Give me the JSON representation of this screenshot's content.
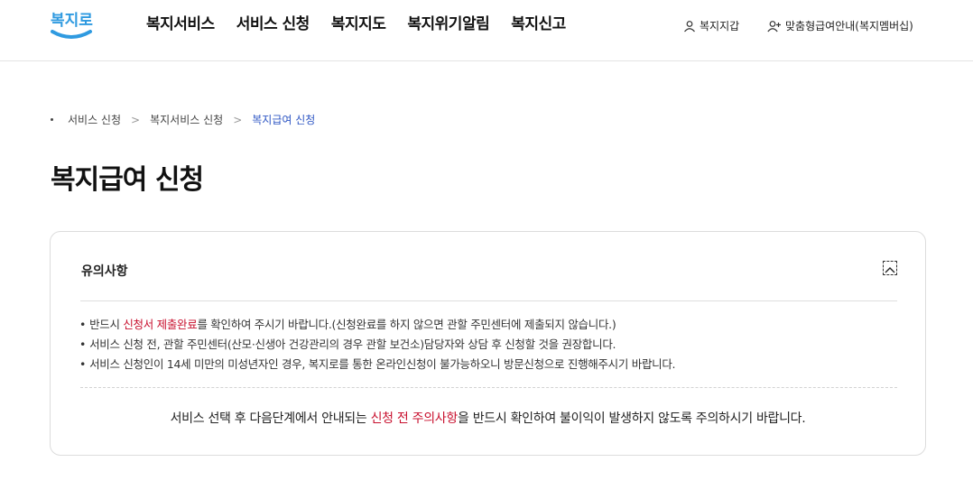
{
  "logo": {
    "text": "복지로",
    "brand_color": "#2f9ae0"
  },
  "gnb": [
    {
      "label": "복지서비스"
    },
    {
      "label": "서비스 신청"
    },
    {
      "label": "복지지도"
    },
    {
      "label": "복지위기알림"
    },
    {
      "label": "복지신고"
    }
  ],
  "util": {
    "wallet": {
      "label": "복지지갑",
      "icon": "user-icon"
    },
    "membership": {
      "label": "맞춤형급여안내(복지멤버십)",
      "icon": "user-plus-icon"
    }
  },
  "breadcrumb": [
    {
      "label": "서비스 신청"
    },
    {
      "label": "복지서비스 신청"
    },
    {
      "label": "복지급여 신청"
    }
  ],
  "page_title": "복지급여 신청",
  "notice": {
    "title": "유의사항",
    "toggle_icon": "chevron-up-icon",
    "items": [
      {
        "pre": "반드시 ",
        "highlight": "신청서 제출완료",
        "post": "를 확인하여 주시기 바랍니다.(신청완료를 하지 않으면 관할 주민센터에 제출되지 않습니다.)"
      },
      {
        "pre": "서비스 신청 전, 관할 주민센터(산모·신생아 건강관리의 경우 관할 보건소)담당자와 상담 후 신청할 것을 권장합니다.",
        "highlight": "",
        "post": ""
      },
      {
        "pre": "서비스 신청인이 14세 미만의 미성년자인 경우, 복지로를 통한 온라인신청이 불가능하오니 방문신청으로 진행해주시기 바랍니다.",
        "highlight": "",
        "post": ""
      }
    ],
    "footer": {
      "pre": "서비스 선택 후 다음단계에서 안내되는 ",
      "highlight": "신청 전 주의사항",
      "post": "을 반드시 확인하여 불이익이 발생하지 않도록 주의하시기 바랍니다."
    },
    "highlight_color": "#c8102e"
  }
}
